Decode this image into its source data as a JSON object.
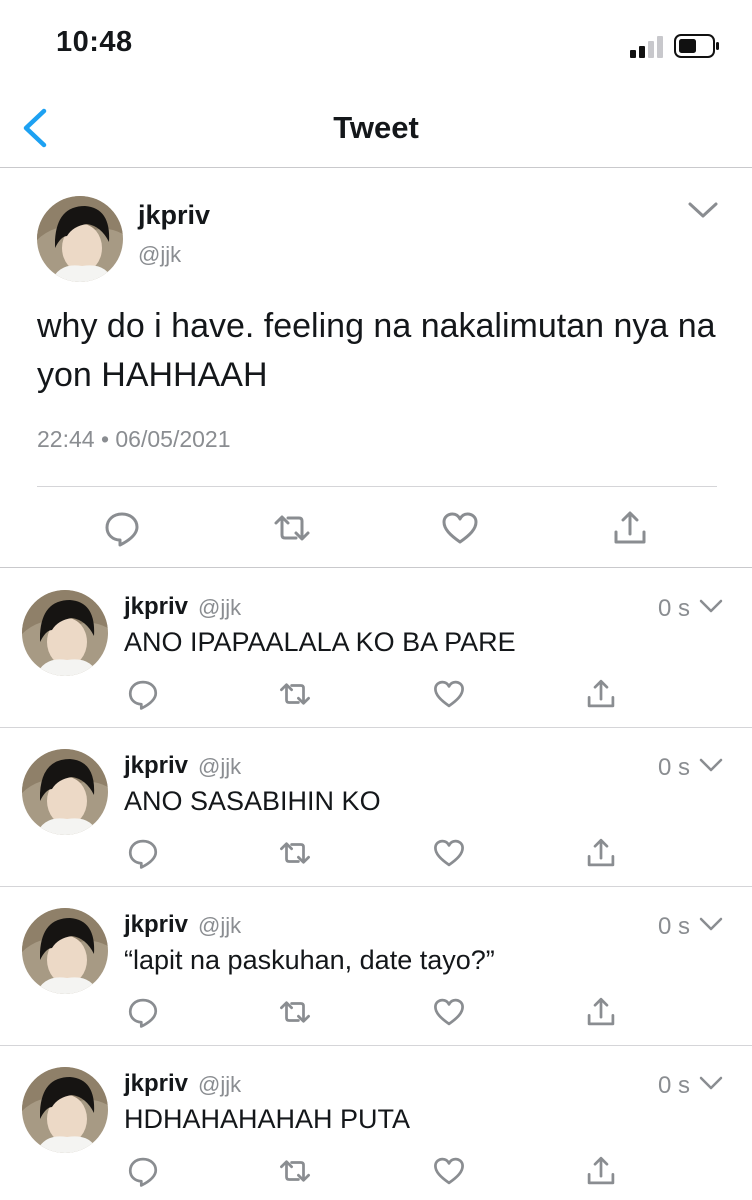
{
  "status_bar": {
    "time": "10:48"
  },
  "nav": {
    "title": "Tweet",
    "back_icon": "chevron-left-icon"
  },
  "colors": {
    "accent": "#1da1f2",
    "text": "#14171a",
    "secondary": "#8a8d91",
    "divider": "#d5d5d8"
  },
  "main_tweet": {
    "display_name": "jkpriv",
    "handle": "@jjk",
    "text": "why do i have. feeling na nakalimutan nya na yon HAHHAAH",
    "timestamp": "22:44 • 06/05/2021",
    "actions": [
      "reply-icon",
      "retweet-icon",
      "like-icon",
      "share-icon"
    ]
  },
  "replies": [
    {
      "display_name": "jkpriv",
      "handle": "@jjk",
      "time": "0 s",
      "text": "ANO IPAPAALALA KO BA PARE"
    },
    {
      "display_name": "jkpriv",
      "handle": "@jjk",
      "time": "0 s",
      "text": "ANO SASABIHIN KO"
    },
    {
      "display_name": "jkpriv",
      "handle": "@jjk",
      "time": "0 s",
      "text": "“lapit na paskuhan, date tayo?”"
    },
    {
      "display_name": "jkpriv",
      "handle": "@jjk",
      "time": "0 s",
      "text": "HDHAHAHAHAH PUTA"
    }
  ]
}
